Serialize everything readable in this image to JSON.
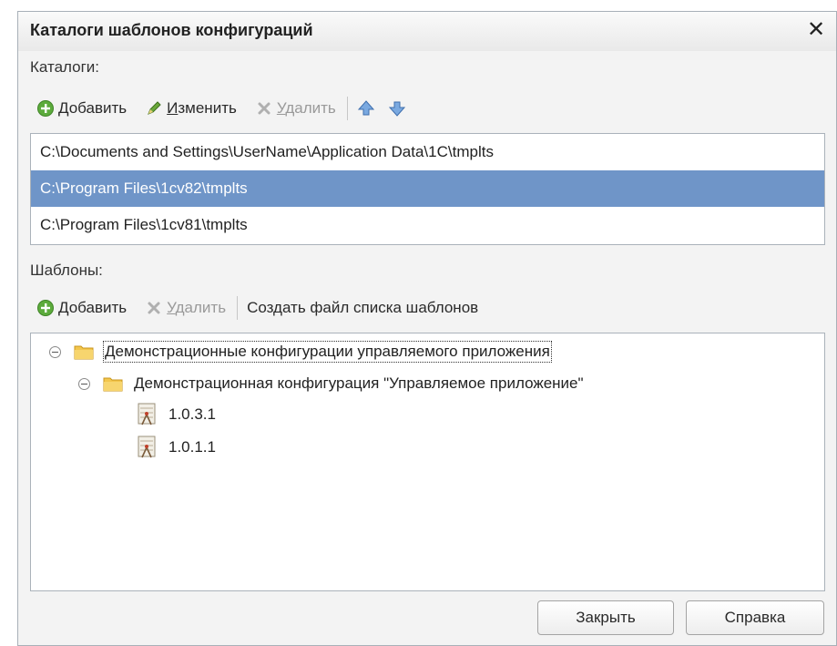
{
  "window": {
    "title": "Каталоги шаблонов конфигураций"
  },
  "catalogs": {
    "label": "Каталоги:",
    "toolbar": {
      "add_prefix": "Д",
      "add_rest": "обавить",
      "edit_prefix": "И",
      "edit_rest": "зменить",
      "delete_prefix": "У",
      "delete_rest": "далить"
    },
    "items": [
      "C:\\Documents and Settings\\UserName\\Application Data\\1C\\tmplts",
      "C:\\Program Files\\1cv82\\tmplts",
      "C:\\Program Files\\1cv81\\tmplts"
    ]
  },
  "templates": {
    "label": "Шаблоны:",
    "toolbar": {
      "add_prefix": "Д",
      "add_rest": "обавить",
      "delete_prefix": "У",
      "delete_rest": "далить",
      "create_list": "Создать файл списка шаблонов"
    },
    "tree": {
      "root": "Демонстрационные конфигурации управляемого приложения",
      "child": "Демонстрационная конфигурация \"Управляемое приложение\"",
      "versions": [
        "1.0.3.1",
        "1.0.1.1"
      ]
    }
  },
  "buttons": {
    "close": "Закрыть",
    "help": "Справка"
  }
}
